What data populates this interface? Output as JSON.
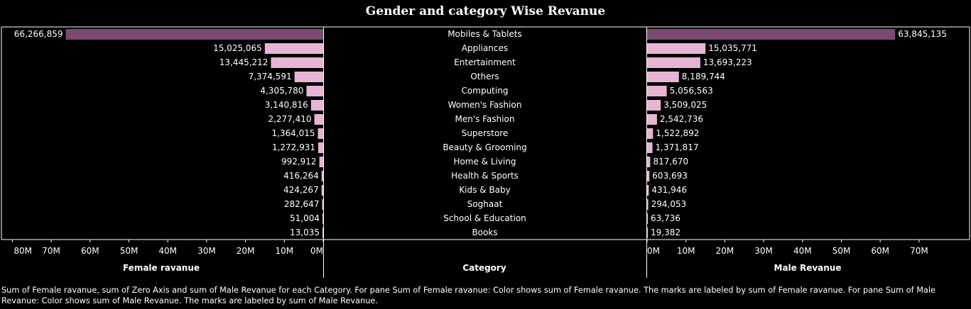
{
  "chart_data": {
    "type": "bar",
    "title": "Gender and category Wise Revanue",
    "categories": [
      "Mobiles & Tablets",
      "Appliances",
      "Entertainment",
      "Others",
      "Computing",
      "Women's Fashion",
      "Men's Fashion",
      "Superstore",
      "Beauty & Grooming",
      "Home & Living",
      "Health & Sports",
      "Kids & Baby",
      "Soghaat",
      "School & Education",
      "Books"
    ],
    "series": [
      {
        "name": "Female ravanue",
        "values": [
          66266859,
          15025065,
          13445212,
          7374591,
          4305780,
          3140816,
          2277410,
          1364015,
          1272931,
          992912,
          416264,
          424267,
          282647,
          51004,
          13035
        ]
      },
      {
        "name": "Male Revanue",
        "values": [
          63845135,
          15035771,
          13693223,
          8189744,
          5056563,
          3509025,
          2542736,
          1522892,
          1371817,
          817670,
          603693,
          431946,
          294053,
          63736,
          19382
        ]
      }
    ],
    "value_labels": {
      "female": [
        "66,266,859",
        "15,025,065",
        "13,445,212",
        "7,374,591",
        "4,305,780",
        "3,140,816",
        "2,277,410",
        "1,364,015",
        "1,272,931",
        "992,912",
        "416,264",
        "424,267",
        "282,647",
        "51,004",
        "13,035"
      ],
      "male": [
        "63,845,135",
        "15,035,771",
        "13,693,223",
        "8,189,744",
        "5,056,563",
        "3,509,025",
        "2,542,736",
        "1,522,892",
        "1,371,817",
        "817,670",
        "603,693",
        "431,946",
        "294,053",
        "63,736",
        "19,382"
      ]
    },
    "female_axis": {
      "title": "Female ravanue",
      "ticks": [
        80000000,
        70000000,
        60000000,
        50000000,
        40000000,
        30000000,
        20000000,
        10000000,
        0
      ],
      "tick_labels": [
        "80M",
        "70M",
        "60M",
        "50M",
        "40M",
        "30M",
        "20M",
        "10M",
        "0M"
      ],
      "reversed": true
    },
    "male_axis": {
      "title": "Male Revanue",
      "ticks": [
        0,
        10000000,
        20000000,
        30000000,
        40000000,
        50000000,
        60000000,
        70000000
      ],
      "tick_labels": [
        "0M",
        "10M",
        "20M",
        "30M",
        "40M",
        "50M",
        "60M",
        "70M"
      ]
    },
    "category_axis_title": "Category",
    "grid": false,
    "colors": {
      "max_bar": "#7b4a72",
      "bar": "#e8b4d6",
      "background": "#000000",
      "text": "#ffffff"
    }
  },
  "caption": "Sum of Female ravanue, sum of Zero Axis and sum of Male Revanue for each Category.  For pane Sum of Female ravanue:  Color shows sum of Female ravanue.  The marks are labeled by sum of Female ravanue.  For pane Sum of Male Revanue:  Color shows sum of Male Revanue.  The marks are labeled by sum of Male Revanue."
}
